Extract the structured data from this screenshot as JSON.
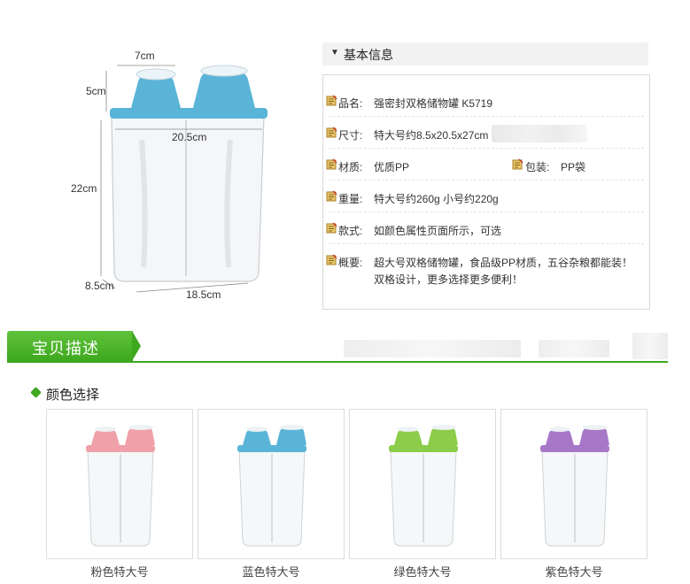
{
  "dimensions": {
    "top_width": "7cm",
    "cap_height": "5cm",
    "lid_width": "20.5cm",
    "height": "22cm",
    "depth": "8.5cm",
    "base_width": "18.5cm",
    "lid_color": "#5ab4d8"
  },
  "info": {
    "header": "基本信息",
    "rows": [
      {
        "key": "品名:",
        "value": "强密封双格储物罐 K5719"
      },
      {
        "key": "尺寸:",
        "value": "特大号约8.5x20.5x27cm"
      },
      {
        "key": "材质:",
        "value": "优质PP",
        "key2": "包装:",
        "value2": "PP袋"
      },
      {
        "key": "重量:",
        "value": "特大号约260g 小号约220g"
      },
      {
        "key": "款式:",
        "value": "如颜色属性页面所示，可选"
      },
      {
        "key": "概要:",
        "value": "超大号双格储物罐，食品级PP材质，五谷杂粮都能装！",
        "value_line2": "双格设计，更多选择更多便利！"
      }
    ]
  },
  "section": {
    "title": "宝贝描述",
    "accent": "#3ea81f"
  },
  "colors": {
    "heading": "颜色选择",
    "options": [
      {
        "label": "粉色特大号",
        "lid": "#f0a0a8"
      },
      {
        "label": "蓝色特大号",
        "lid": "#5ab4d8"
      },
      {
        "label": "绿色特大号",
        "lid": "#8ccc4a"
      },
      {
        "label": "紫色特大号",
        "lid": "#a878c8"
      }
    ]
  }
}
